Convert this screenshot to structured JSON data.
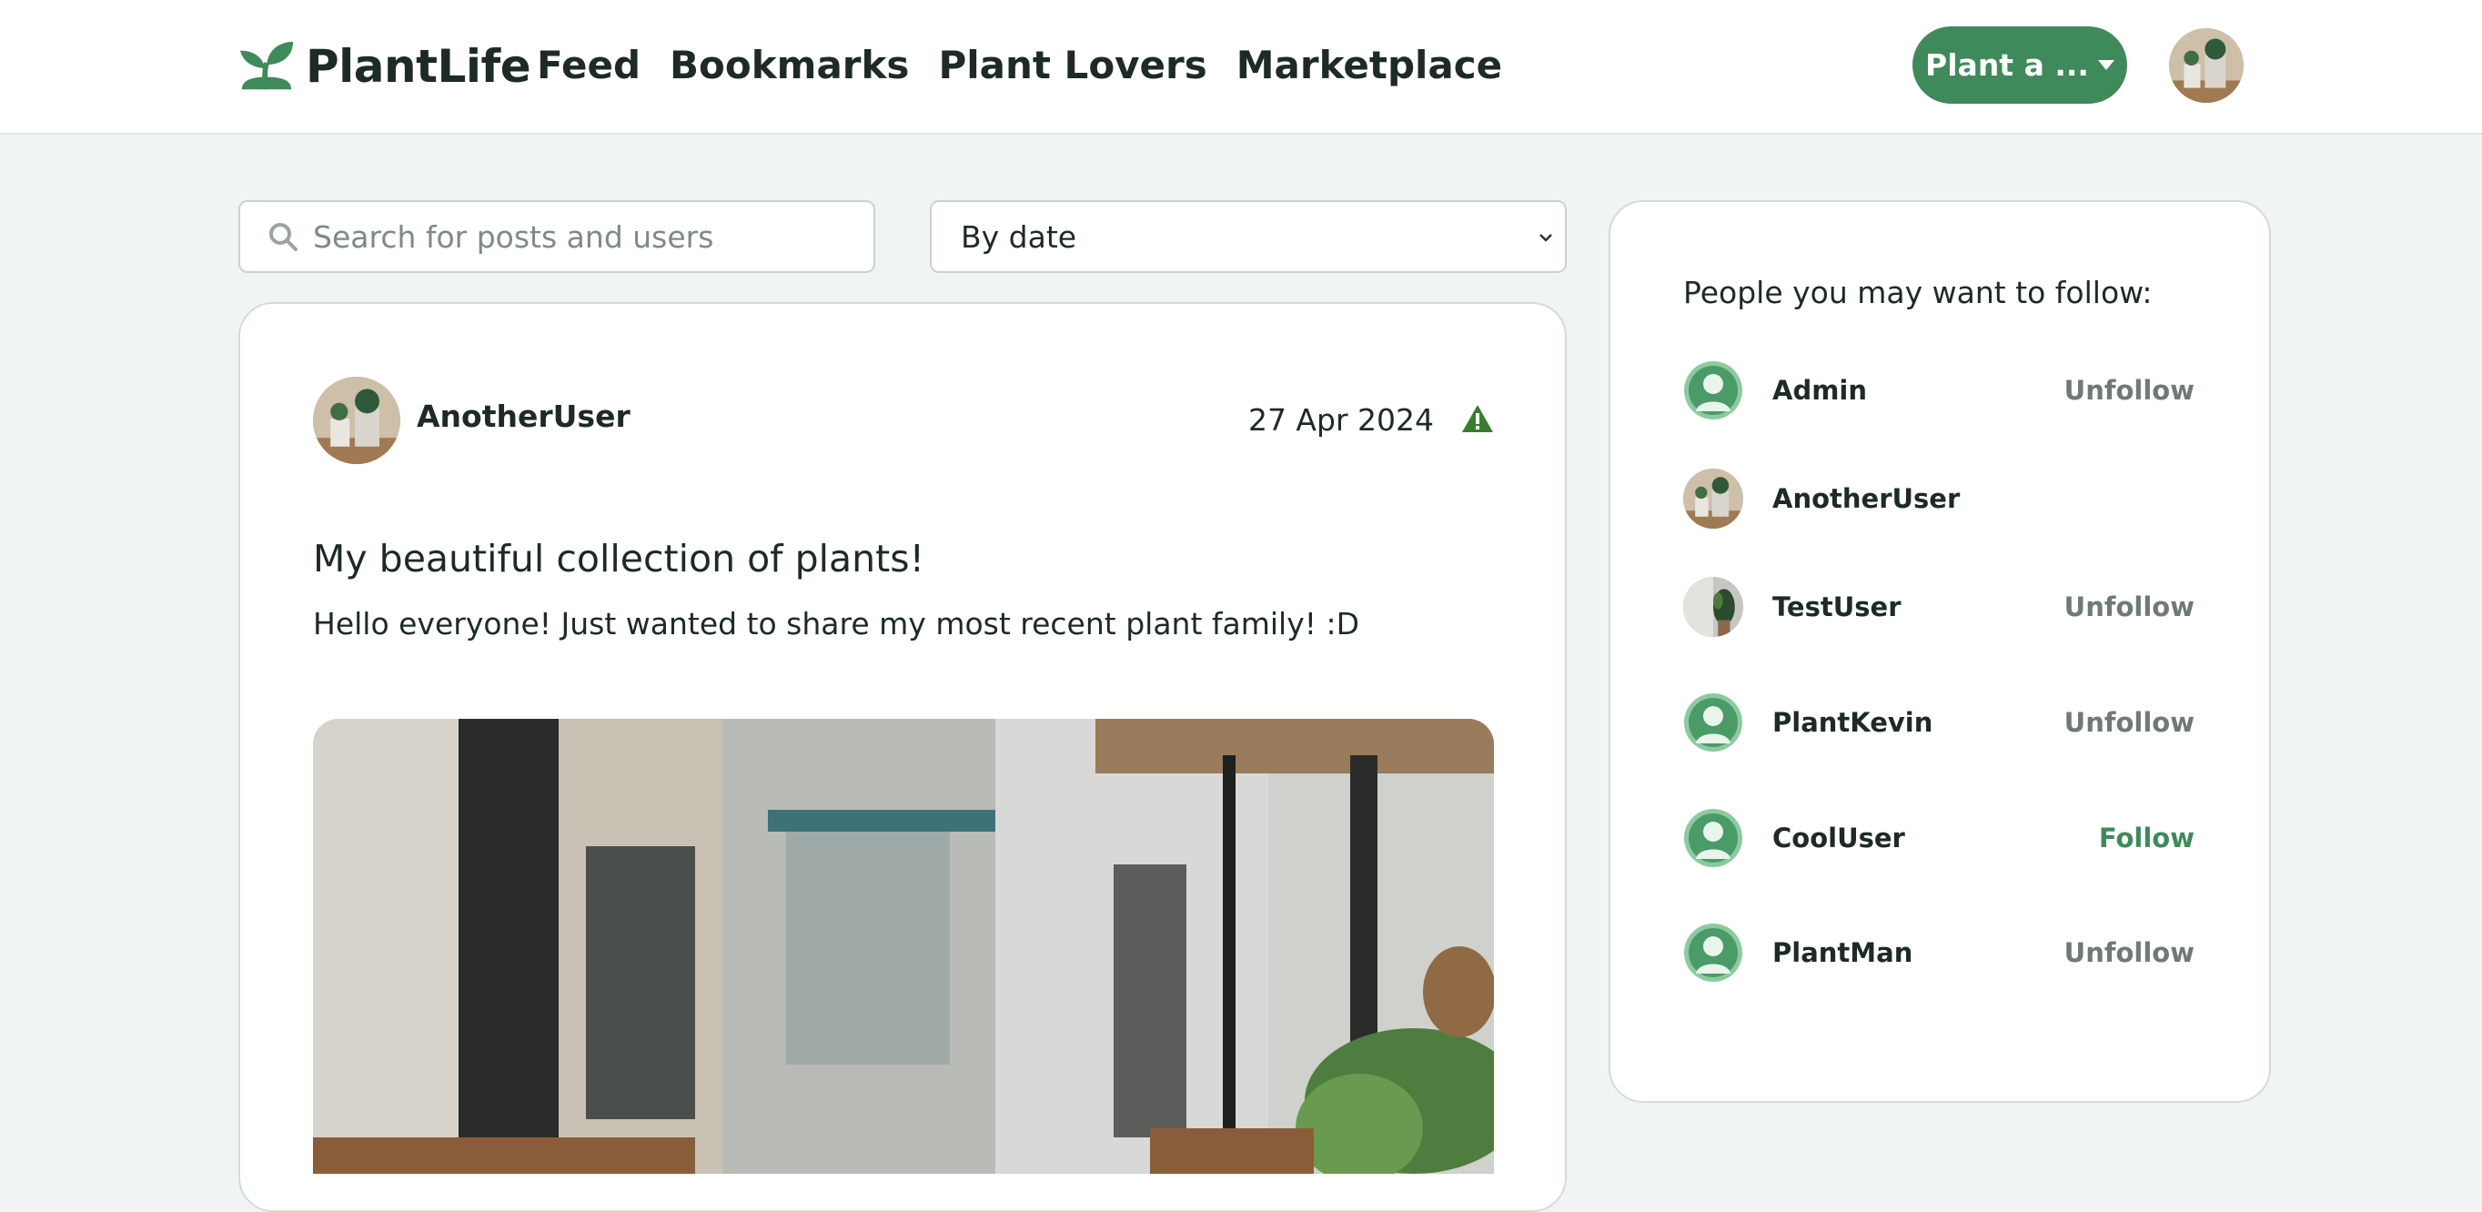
{
  "brand": {
    "name": "PlantLife",
    "color": "#3f8a5a"
  },
  "nav": {
    "links": [
      "Feed",
      "Bookmarks",
      "Plant Lovers",
      "Marketplace"
    ],
    "plant_button": "Plant a ..."
  },
  "search": {
    "placeholder": "Search for posts and users",
    "value": ""
  },
  "sort": {
    "selected": "By date"
  },
  "post": {
    "author": "AnotherUser",
    "date": "27 Apr 2024",
    "title": "My beautiful collection of plants!",
    "body": "Hello everyone! Just wanted to share my most recent plant family! :D"
  },
  "follow_panel": {
    "title": "People you may want to follow:",
    "people": [
      {
        "name": "Admin",
        "action": "Unfollow",
        "avatar": "default-avatar-icon"
      },
      {
        "name": "AnotherUser",
        "action": "",
        "avatar": "plant-photo"
      },
      {
        "name": "TestUser",
        "action": "Unfollow",
        "avatar": "plant-photo"
      },
      {
        "name": "PlantKevin",
        "action": "Unfollow",
        "avatar": "default-avatar-icon"
      },
      {
        "name": "CoolUser",
        "action": "Follow",
        "avatar": "default-avatar-icon"
      },
      {
        "name": "PlantMan",
        "action": "Unfollow",
        "avatar": "default-avatar-icon"
      }
    ]
  },
  "colors": {
    "accent": "#3f8a5a",
    "background": "#f0f4f5",
    "muted": "#6f7976"
  }
}
